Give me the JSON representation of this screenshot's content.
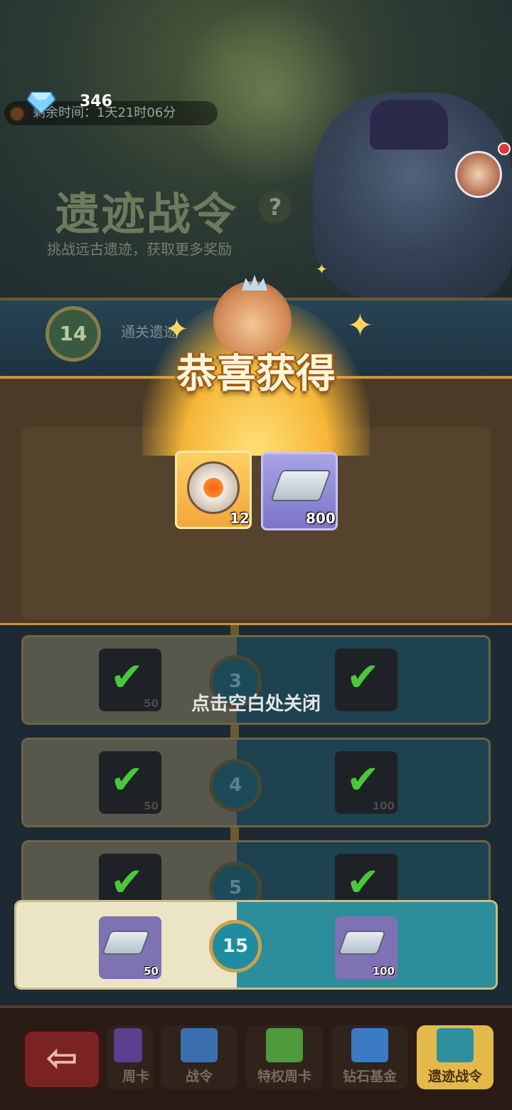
{
  "header": {
    "gem_count": "346",
    "remaining_time": "剩余时间：1天21时06分",
    "title": "遗迹战令",
    "help": "?",
    "subtitle": "挑战远古遗迹，获取更多奖励"
  },
  "progress": {
    "level": "14",
    "label": "通关遗迹"
  },
  "popup": {
    "title": "恭喜获得",
    "rewards": [
      {
        "icon": "medal-icon",
        "count": "12"
      },
      {
        "icon": "silver-ingot-icon",
        "count": "800"
      }
    ],
    "close_hint": "点击空白处关闭"
  },
  "tiers": [
    {
      "level": "3",
      "free_count": "50",
      "paid_count": ""
    },
    {
      "level": "4",
      "free_count": "50",
      "paid_count": "100"
    },
    {
      "level": "5",
      "free_count": "",
      "paid_count": ""
    },
    {
      "level": "15",
      "free_count": "50",
      "paid_count": "100"
    }
  ],
  "nav": {
    "back": "⇦",
    "tabs": [
      "周卡",
      "战令",
      "特权周卡",
      "钻石基金",
      "遗迹战令"
    ]
  },
  "colors": {
    "accent_gold": "#e3b949",
    "teal": "#2c8d9b",
    "check_green": "#49c83a"
  }
}
